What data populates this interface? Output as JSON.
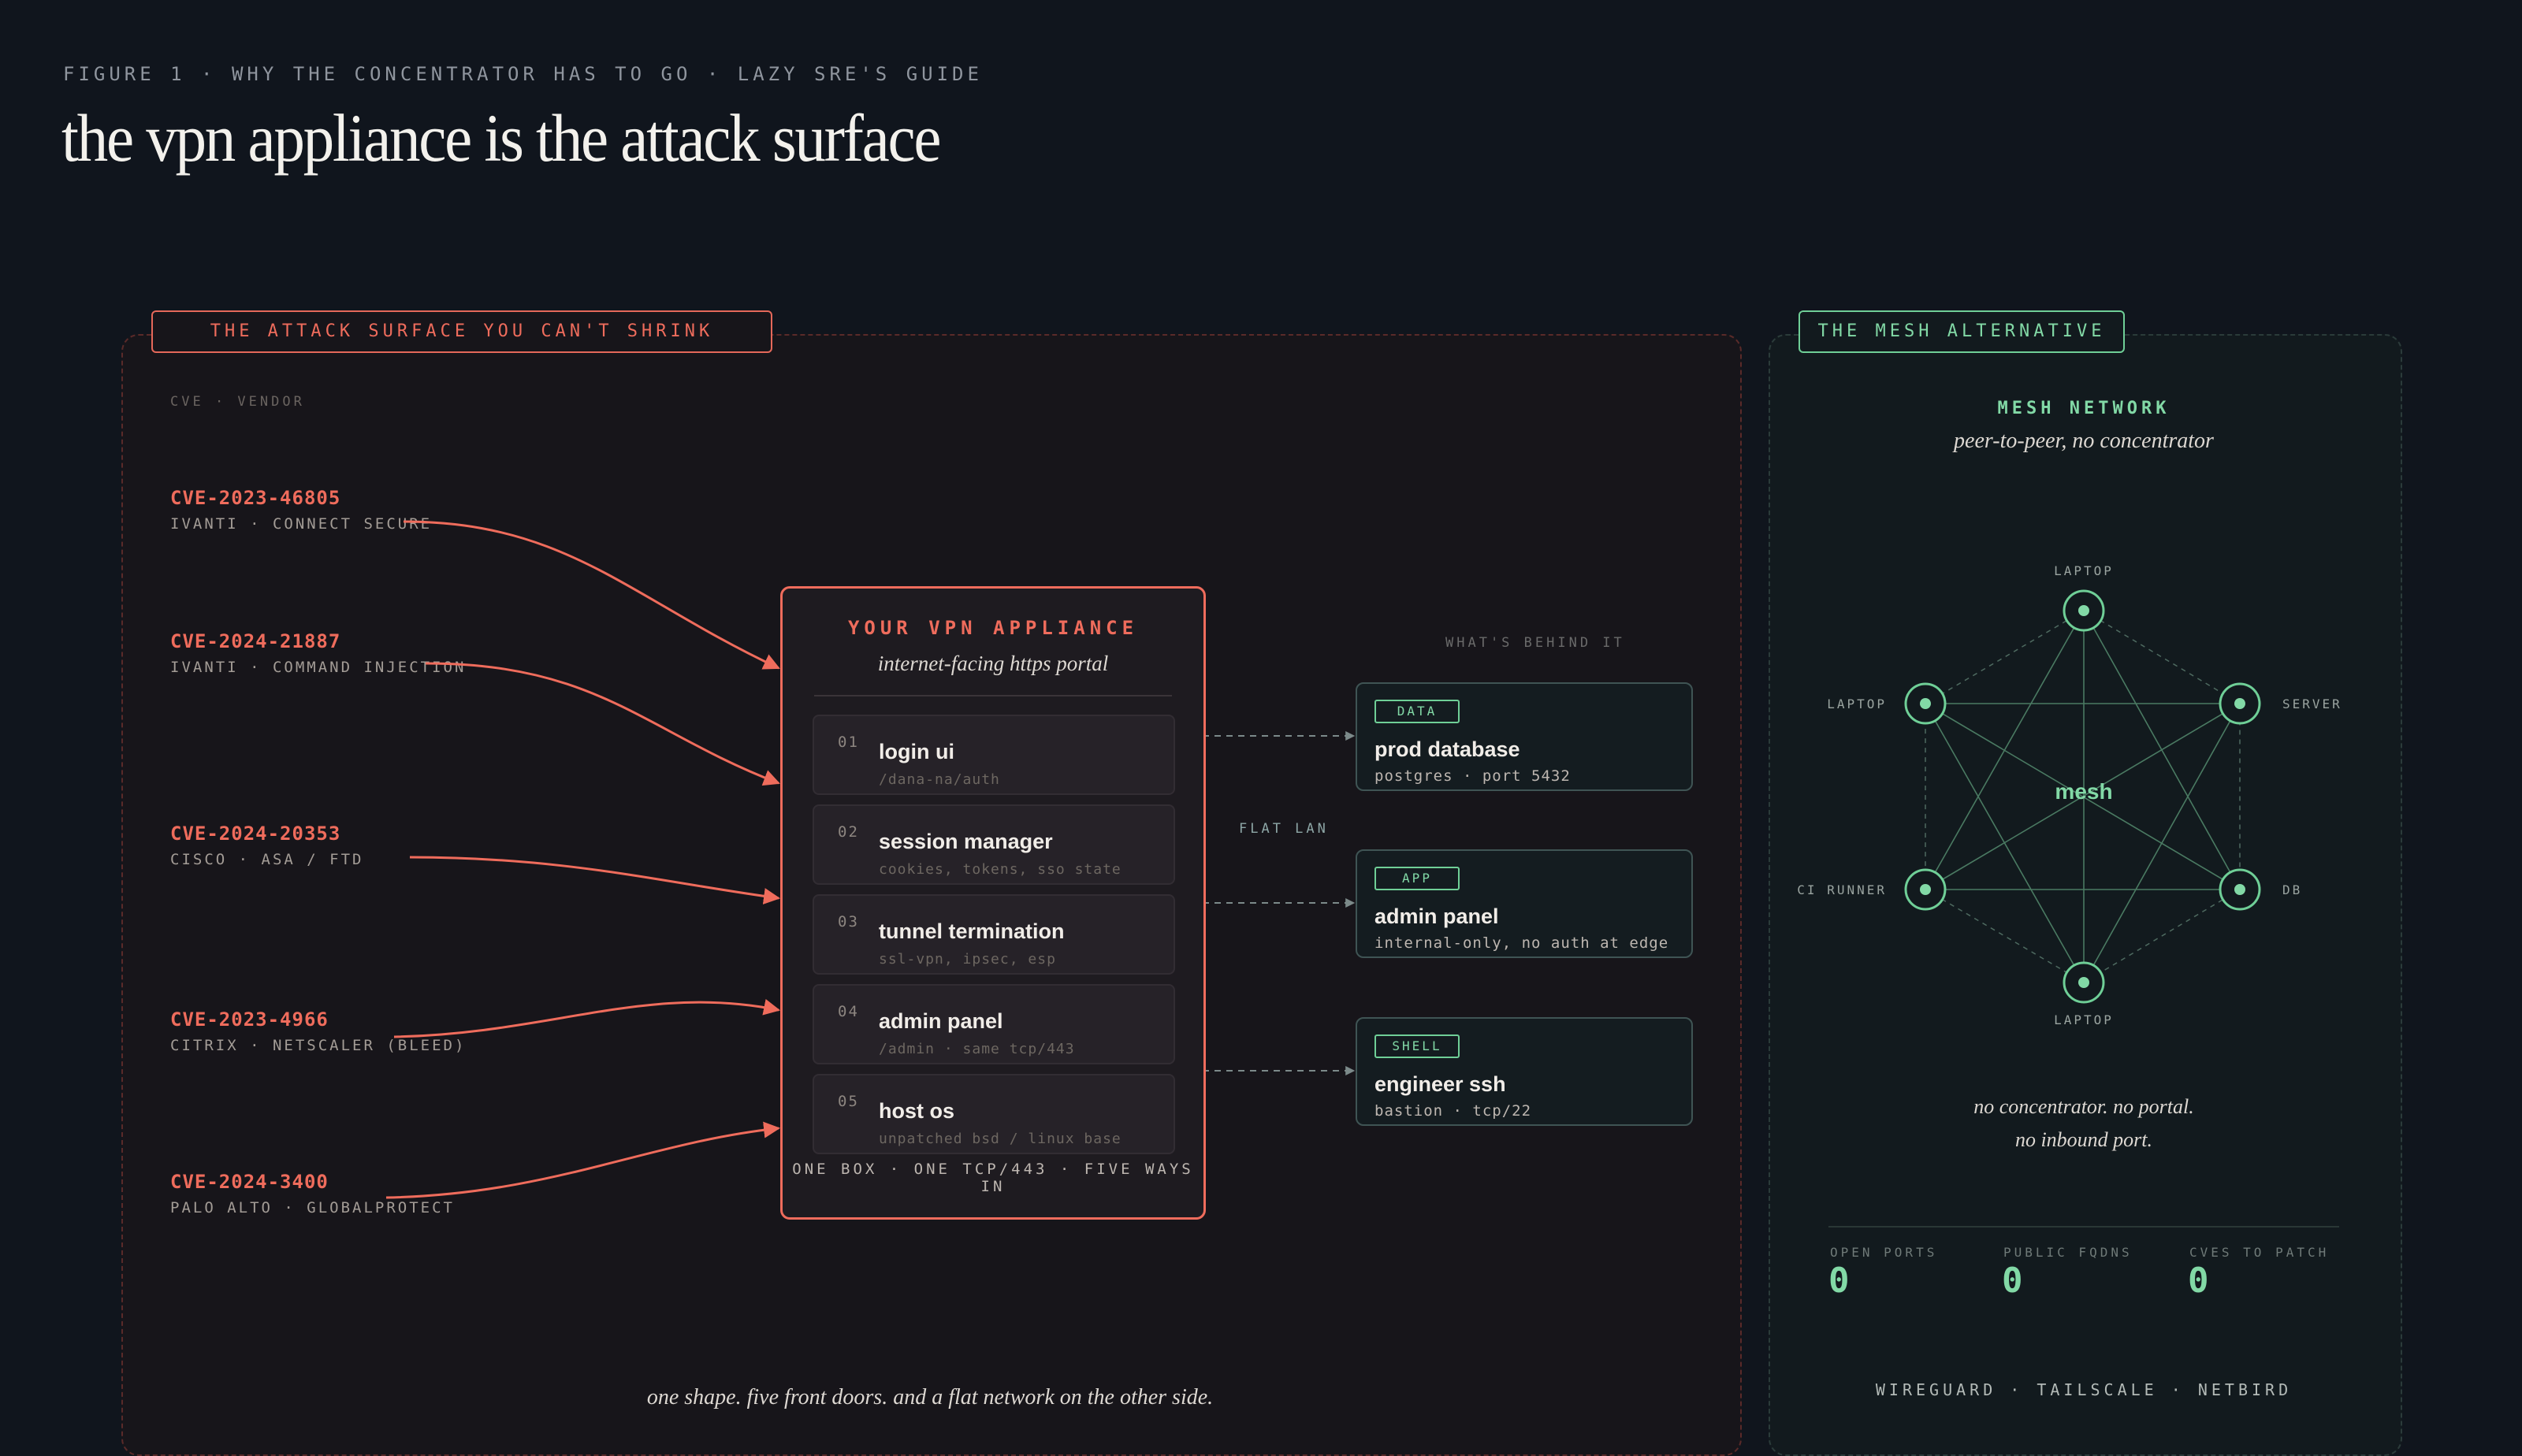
{
  "header": {
    "eyebrow": "FIGURE 1 · WHY THE CONCENTRATOR HAS TO GO · LAZY SRE'S GUIDE",
    "title": "the vpn appliance is the attack surface"
  },
  "left_panel": {
    "tag": "THE ATTACK SURFACE YOU CAN'T SHRINK",
    "cve_heading": "CVE · VENDOR",
    "cves": [
      {
        "id": "CVE-2023-46805",
        "vendor": "IVANTI · CONNECT SECURE"
      },
      {
        "id": "CVE-2024-21887",
        "vendor": "IVANTI · COMMAND INJECTION"
      },
      {
        "id": "CVE-2024-20353",
        "vendor": "CISCO · ASA / FTD"
      },
      {
        "id": "CVE-2023-4966",
        "vendor": "CITRIX · NETSCALER (BLEED)"
      },
      {
        "id": "CVE-2024-3400",
        "vendor": "PALO ALTO · GLOBALPROTECT"
      }
    ],
    "appliance": {
      "title": "YOUR VPN APPLIANCE",
      "subtitle": "internet-facing https portal",
      "layers": [
        {
          "num": "01",
          "title": "login ui",
          "sub": "/dana-na/auth"
        },
        {
          "num": "02",
          "title": "session manager",
          "sub": "cookies, tokens, sso state"
        },
        {
          "num": "03",
          "title": "tunnel termination",
          "sub": "ssl-vpn, ipsec, esp"
        },
        {
          "num": "04",
          "title": "admin panel",
          "sub": "/admin · same tcp/443"
        },
        {
          "num": "05",
          "title": "host os",
          "sub": "unpatched bsd / linux base"
        }
      ],
      "footer": "ONE BOX · ONE TCP/443 · FIVE WAYS IN"
    },
    "behind_heading": "WHAT'S BEHIND IT",
    "flat_lan": "FLAT LAN",
    "behind": [
      {
        "tag": "DATA",
        "name": "prod database",
        "detail": "postgres · port 5432"
      },
      {
        "tag": "APP",
        "name": "admin panel",
        "detail": "internal-only, no auth at edge"
      },
      {
        "tag": "SHELL",
        "name": "engineer ssh",
        "detail": "bastion · tcp/22"
      }
    ],
    "caption": "one shape. five front doors. and a flat network on the other side."
  },
  "right_panel": {
    "tag": "THE MESH ALTERNATIVE",
    "heading": "MESH NETWORK",
    "subtitle": "peer-to-peer, no concentrator",
    "center_label": "mesh",
    "nodes": [
      "LAPTOP",
      "SERVER",
      "DB",
      "LAPTOP",
      "CI RUNNER",
      "LAPTOP"
    ],
    "caption_line1": "no concentrator. no portal.",
    "caption_line2": "no inbound port.",
    "stats": [
      {
        "label": "OPEN PORTS",
        "value": "0"
      },
      {
        "label": "PUBLIC FQDNS",
        "value": "0"
      },
      {
        "label": "CVES TO PATCH",
        "value": "0"
      }
    ],
    "footer": "WIREGUARD · TAILSCALE · NETBIRD"
  },
  "colors": {
    "background": "#10151d",
    "attack_accent": "#ef6c5c",
    "mesh_accent": "#6fcf97"
  }
}
